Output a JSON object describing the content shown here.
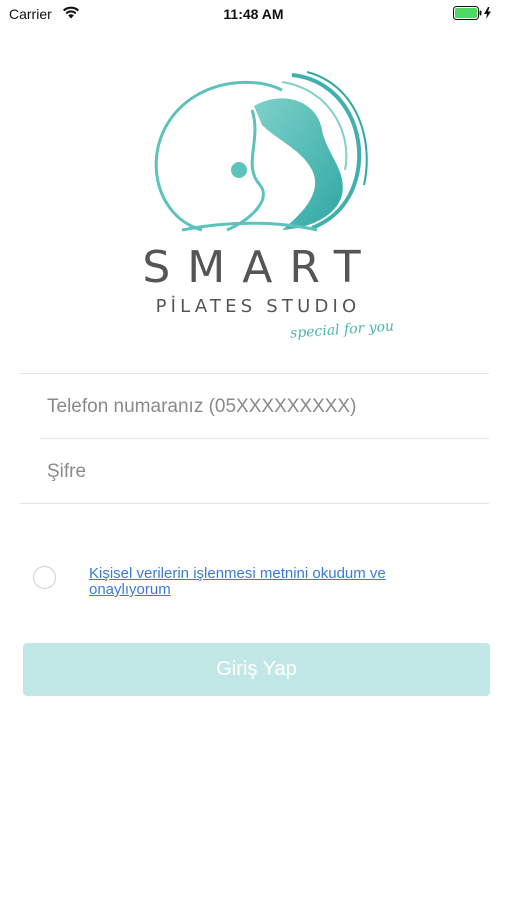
{
  "status_bar": {
    "carrier": "Carrier",
    "time": "11:48 AM",
    "wifi_icon": "wifi-icon",
    "battery_icon": "battery-charging-icon",
    "battery_color": "#4cd964"
  },
  "logo": {
    "title": "SMART",
    "subtitle": "PİLATES STUDIO",
    "tagline": "special for you",
    "brand_color": "#4ab7b0"
  },
  "login_form": {
    "phone_placeholder": "Telefon numaranız (05XXXXXXXXX)",
    "password_placeholder": "Şifre",
    "phone_value": "",
    "password_value": ""
  },
  "consent": {
    "checked": false,
    "label": "Kişisel verilerin işlenmesi metnini okudum ve onaylıyorum",
    "link_color": "#3b7bd8"
  },
  "login_button": {
    "label": "Giriş Yap",
    "background": "#c1e8e6",
    "disabled": true
  }
}
